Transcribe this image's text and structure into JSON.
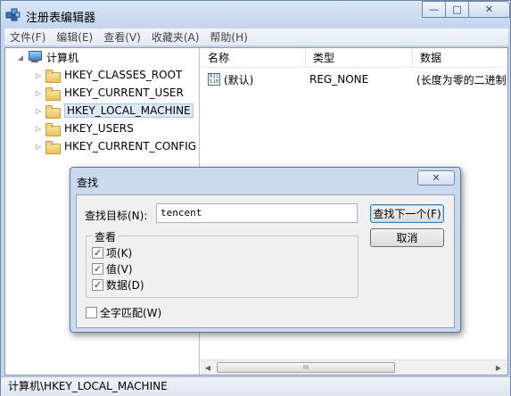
{
  "window": {
    "title": "注册表编辑器",
    "minimize_glyph": "—",
    "maximize_glyph": "□",
    "close_glyph": "✕"
  },
  "menu": [
    "文件(F)",
    "编辑(E)",
    "查看(V)",
    "收藏夹(A)",
    "帮助(H)"
  ],
  "tree": {
    "root": "计算机",
    "items": [
      {
        "label": "HKEY_CLASSES_ROOT"
      },
      {
        "label": "HKEY_CURRENT_USER"
      },
      {
        "label": "HKEY_LOCAL_MACHINE",
        "selected": true
      },
      {
        "label": "HKEY_USERS"
      },
      {
        "label": "HKEY_CURRENT_CONFIG"
      }
    ]
  },
  "list": {
    "columns": [
      "名称",
      "类型",
      "数据"
    ],
    "rows": [
      {
        "name": "(默认)",
        "type": "REG_NONE",
        "data": "(长度为零的二进制"
      }
    ],
    "scroll_grip": "III"
  },
  "status": "计算机\\HKEY_LOCAL_MACHINE",
  "find_dialog": {
    "title": "查找",
    "close_glyph": "✕",
    "target_label": "查找目标(N):",
    "target_value": "tencent",
    "find_next_label": "查找下一个(F)",
    "cancel_label": "取消",
    "look_at_label": "查看",
    "options": [
      {
        "label": "项(K)",
        "checked": true
      },
      {
        "label": "值(V)",
        "checked": true
      },
      {
        "label": "数据(D)",
        "checked": true
      }
    ],
    "whole_match_label": "全字匹配(W)",
    "whole_match_checked": false
  },
  "colors": {
    "frame": "#c9d9ee",
    "selection": "#dde9f7",
    "accent": "#3c7fb1"
  }
}
